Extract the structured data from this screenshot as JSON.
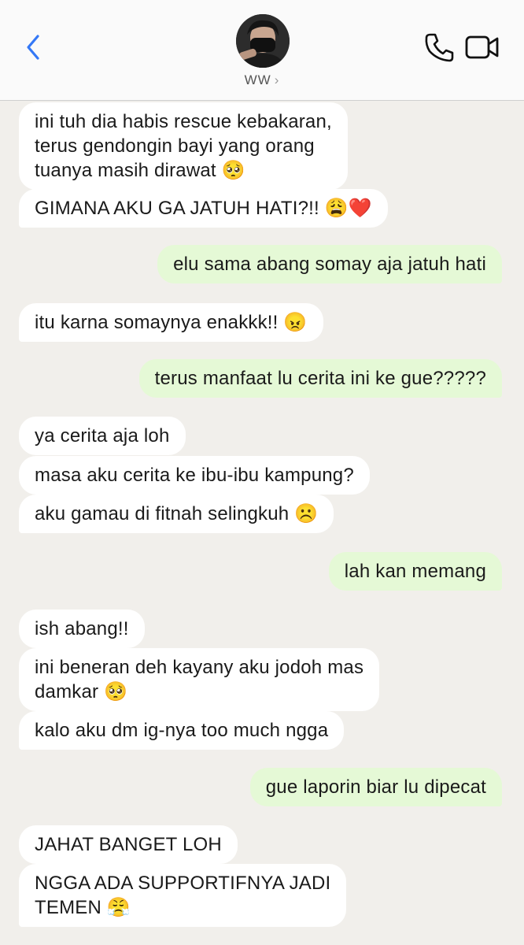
{
  "header": {
    "contact_name": "WW",
    "chevron": "›",
    "icons": [
      "back-chevron-icon",
      "phone-icon",
      "video-call-icon"
    ]
  },
  "messages": [
    {
      "dir": "in",
      "lines": [
        "ini tuh dia habis rescue kebakaran,",
        "terus gendongin bayi yang orang",
        "tuanya masih  dirawat 🥺"
      ]
    },
    {
      "dir": "in",
      "lines": [
        "GIMANA AKU GA JATUH HATI?!! 😩❤️"
      ]
    },
    {
      "dir": "out",
      "lines": [
        "elu sama abang somay aja jatuh hati"
      ]
    },
    {
      "dir": "in",
      "lines": [
        "itu karna somaynya enakkk!! 😠"
      ]
    },
    {
      "dir": "out",
      "lines": [
        "terus manfaat lu cerita ini ke gue?????"
      ]
    },
    {
      "dir": "in",
      "lines": [
        "ya cerita aja loh"
      ]
    },
    {
      "dir": "in",
      "lines": [
        "masa aku cerita ke ibu-ibu kampung?"
      ]
    },
    {
      "dir": "in",
      "lines": [
        "aku gamau di fitnah selingkuh ☹️"
      ]
    },
    {
      "dir": "out",
      "lines": [
        "lah kan memang"
      ]
    },
    {
      "dir": "in",
      "lines": [
        "ish abang!!"
      ]
    },
    {
      "dir": "in",
      "lines": [
        "ini beneran deh kayany aku jodoh mas",
        "damkar 🥺"
      ]
    },
    {
      "dir": "in",
      "lines": [
        "kalo aku dm ig-nya too much ngga"
      ]
    },
    {
      "dir": "out",
      "lines": [
        "gue laporin biar lu dipecat"
      ]
    },
    {
      "dir": "in",
      "lines": [
        "JAHAT BANGET LOH"
      ]
    },
    {
      "dir": "in",
      "lines": [
        "NGGA ADA SUPPORTIFNYA JADI",
        "TEMEN 😤"
      ]
    }
  ]
}
